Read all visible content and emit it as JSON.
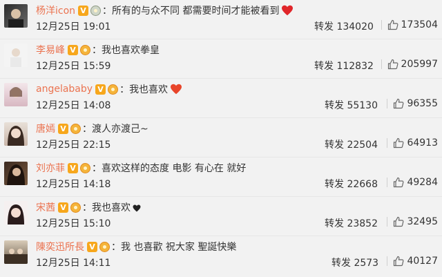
{
  "colors": {
    "username": "#eb7350",
    "badge": "#f7a71c",
    "heart": "#e0262a"
  },
  "repost_label": "转发",
  "comments": [
    {
      "user": "杨洋icon",
      "text": "所有的与众不同 都需要时间才能被看到",
      "emoji": "heart",
      "medal": "silver",
      "time": "12月25日 19:01",
      "reposts": "134020",
      "likes": "173504"
    },
    {
      "user": "李易峰",
      "text": "我也喜欢拳皇",
      "emoji": "",
      "medal": "gold",
      "time": "12月25日 15:59",
      "reposts": "112832",
      "likes": "205997"
    },
    {
      "user": "angelababy",
      "text": "我也喜欢",
      "emoji": "heart",
      "medal": "gold",
      "time": "12月25日 14:08",
      "reposts": "55130",
      "likes": "96355"
    },
    {
      "user": "唐嫣",
      "text": "渡人亦渡己~",
      "emoji": "",
      "medal": "gold",
      "time": "12月25日 22:15",
      "reposts": "22504",
      "likes": "64913"
    },
    {
      "user": "刘亦菲",
      "text": "喜欢这样的态度 电影 有心在 就好",
      "emoji": "",
      "medal": "gold",
      "time": "12月25日 14:18",
      "reposts": "22668",
      "likes": "49284"
    },
    {
      "user": "宋茜",
      "text": "我也喜欢",
      "emoji": "small-heart",
      "medal": "gold",
      "time": "12月25日 15:10",
      "reposts": "23852",
      "likes": "32495"
    },
    {
      "user": "陳奕迅所長",
      "text": "我 也喜歡 祝大家 聖誕快樂",
      "emoji": "",
      "medal": "gold",
      "time": "12月25日 14:11",
      "reposts": "2573",
      "likes": "40127"
    }
  ]
}
